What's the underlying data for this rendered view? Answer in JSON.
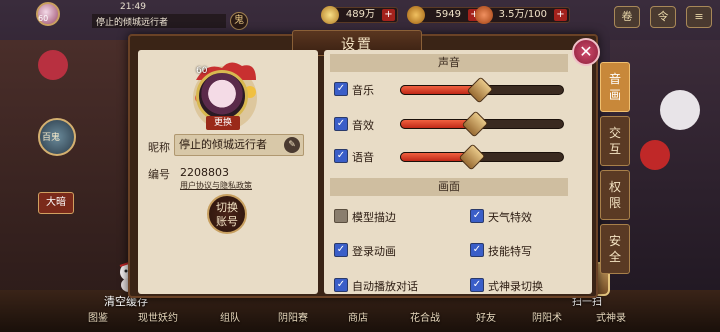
{
  "hud": {
    "level": "60",
    "time": "21:49",
    "player_name": "停止的倾城远行者",
    "bell_icon": "鬼",
    "jade": "489万",
    "gold": "5949",
    "stamina": "3.5万/100",
    "plus": "+",
    "buttons": [
      "卷",
      "令"
    ]
  },
  "dialog": {
    "title": "设置",
    "close": "✕",
    "avatar": {
      "level": "60",
      "change": "更换"
    },
    "nickname_label": "昵称",
    "nickname": "停止的倾城远行者",
    "edit_icon": "✎",
    "uid_label": "编号",
    "uid": "2208803",
    "policy": "用户协议与隐私政策",
    "switch_account": [
      "切换",
      "账号"
    ],
    "sound": {
      "header": "声音",
      "sliders": [
        {
          "label": "音乐",
          "value": 0.49
        },
        {
          "label": "音效",
          "value": 0.46
        },
        {
          "label": "语音",
          "value": 0.44
        }
      ]
    },
    "graphics": {
      "header": "画面",
      "options": [
        {
          "label": "模型描边",
          "checked": false
        },
        {
          "label": "天气特效",
          "checked": true
        },
        {
          "label": "登录动画",
          "checked": true
        },
        {
          "label": "技能特写",
          "checked": true
        },
        {
          "label": "自动播放对话",
          "checked": true
        },
        {
          "label": "式神录切换",
          "checked": true
        }
      ]
    },
    "tabs": [
      {
        "label": [
          "音",
          "画"
        ],
        "active": true
      },
      {
        "label": [
          "交",
          "互"
        ],
        "active": false
      },
      {
        "label": [
          "权",
          "限"
        ],
        "active": false
      },
      {
        "label": [
          "安",
          "全"
        ],
        "active": false
      }
    ]
  },
  "left": {
    "badge": "百鬼",
    "daiming": "大暗"
  },
  "bottom": {
    "clear_cache": "清空缓存",
    "scan": "扫一扫",
    "items": [
      "图鉴",
      "现世妖约",
      "组队",
      "阴阳寮",
      "商店",
      "花合战",
      "好友",
      "阴阳术",
      "式神录"
    ]
  },
  "colors": {
    "accent": "#3a5ec8",
    "panel": "#e8dcc6",
    "frame": "#3a2416",
    "slider": "#e04830"
  }
}
